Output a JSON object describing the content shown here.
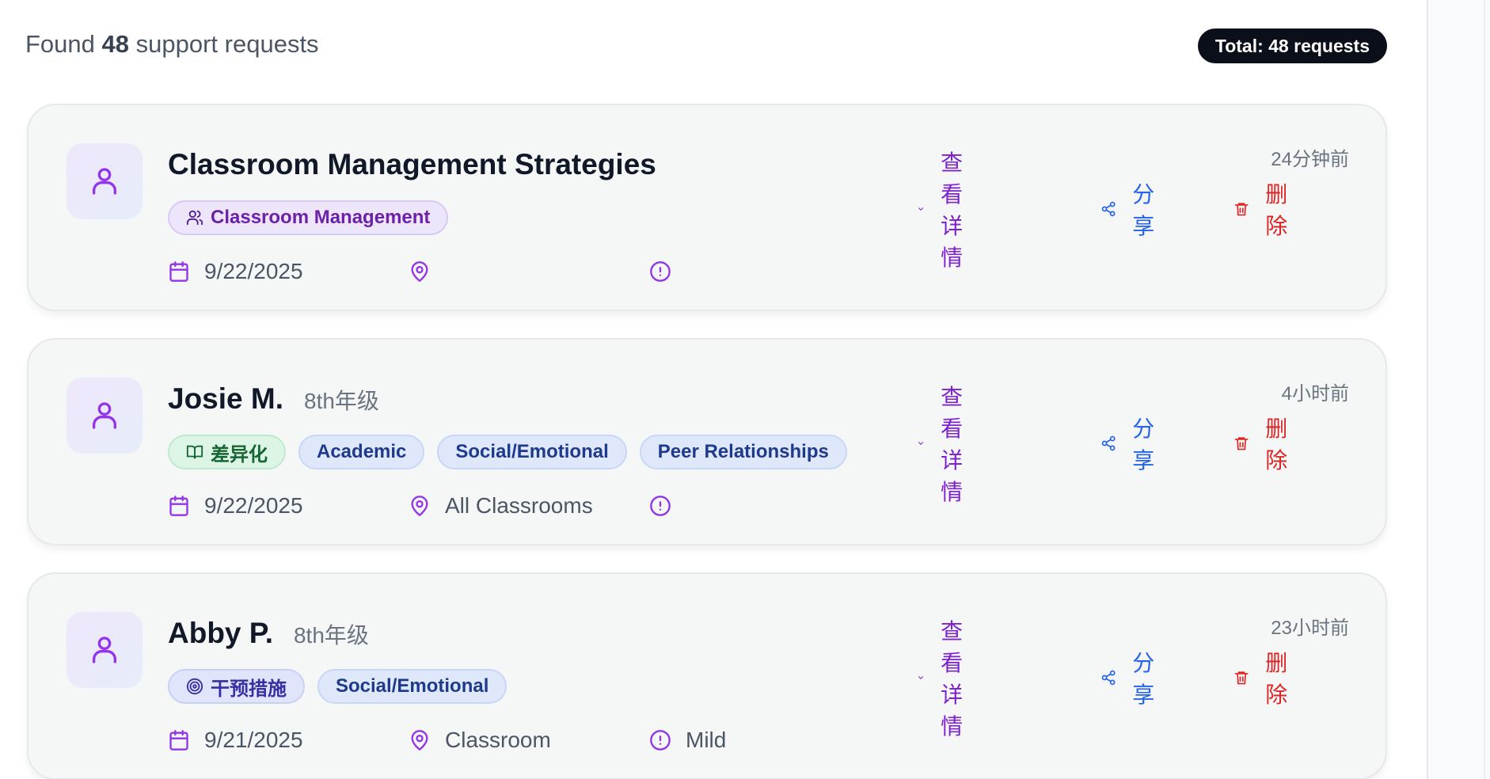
{
  "summary": {
    "prefix": "Found",
    "count": "48",
    "suffix": "support requests"
  },
  "total_badge": "Total: 48 requests",
  "colors": {
    "purple": "#7e22ce",
    "blue": "#2563eb",
    "red": "#dc2626",
    "dark": "#0b0f19"
  },
  "actions": {
    "view": "查看详情",
    "share": "分享",
    "delete": "删除"
  },
  "cards": [
    {
      "name": "Classroom Management Strategies",
      "grade": "",
      "time_ago": "24分钟前",
      "tags": [
        {
          "icon": "users-icon",
          "label": "Classroom Management",
          "style": "purple"
        }
      ],
      "date": "9/22/2025",
      "location": "",
      "severity": ""
    },
    {
      "name": "Josie M.",
      "grade": "8th年级",
      "time_ago": "4小时前",
      "tags": [
        {
          "icon": "book-open-icon",
          "label": "差异化",
          "style": "green"
        },
        {
          "icon": "",
          "label": "Academic",
          "style": "blue"
        },
        {
          "icon": "",
          "label": "Social/Emotional",
          "style": "blue"
        },
        {
          "icon": "",
          "label": "Peer Relationships",
          "style": "blue"
        }
      ],
      "date": "9/22/2025",
      "location": "All Classrooms",
      "severity": ""
    },
    {
      "name": "Abby P.",
      "grade": "8th年级",
      "time_ago": "23小时前",
      "tags": [
        {
          "icon": "target-icon",
          "label": "干预措施",
          "style": "indigo"
        },
        {
          "icon": "",
          "label": "Social/Emotional",
          "style": "blue"
        }
      ],
      "date": "9/21/2025",
      "location": "Classroom",
      "severity": "Mild"
    }
  ]
}
